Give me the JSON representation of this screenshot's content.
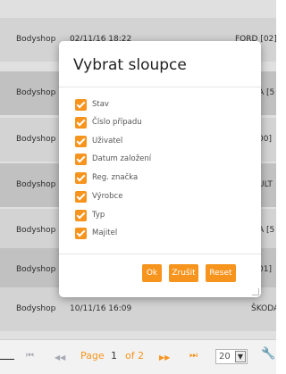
{
  "table": {
    "rows": [
      {
        "name": "Bodyshop",
        "date": "02/11/16 18:22",
        "right": "FORD [02]"
      },
      {
        "name": "Bodyshop",
        "date": "",
        "right": "A [5"
      },
      {
        "name": "Bodyshop",
        "date": "",
        "right": "00]"
      },
      {
        "name": "Bodyshop",
        "date": "",
        "right": "ULT"
      },
      {
        "name": "Bodyshop",
        "date": "",
        "right": "A [5"
      },
      {
        "name": "Bodyshop",
        "date": "",
        "right": "01]"
      },
      {
        "name": "Bodyshop",
        "date": "10/11/16 16:09",
        "right": "ŠKODA [5"
      }
    ]
  },
  "dialog": {
    "title": "Vybrat sloupce",
    "options": [
      {
        "label": "Stav",
        "checked": true
      },
      {
        "label": "Číslo případu",
        "checked": true
      },
      {
        "label": "Uživatel",
        "checked": true
      },
      {
        "label": "Datum založení",
        "checked": true
      },
      {
        "label": "Reg. značka",
        "checked": true
      },
      {
        "label": "Výrobce",
        "checked": true
      },
      {
        "label": "Typ",
        "checked": true
      },
      {
        "label": "Majitel",
        "checked": true
      }
    ],
    "buttons": {
      "ok": "Ok",
      "cancel": "Zrušit",
      "reset": "Reset"
    }
  },
  "pager": {
    "first": "⏮",
    "prev": "◀◀",
    "page_label": "Page",
    "current_page": "1",
    "of_label": "of 2",
    "next": "▶▶",
    "last": "⏭",
    "page_size": "20",
    "accent": "#f7941d"
  }
}
